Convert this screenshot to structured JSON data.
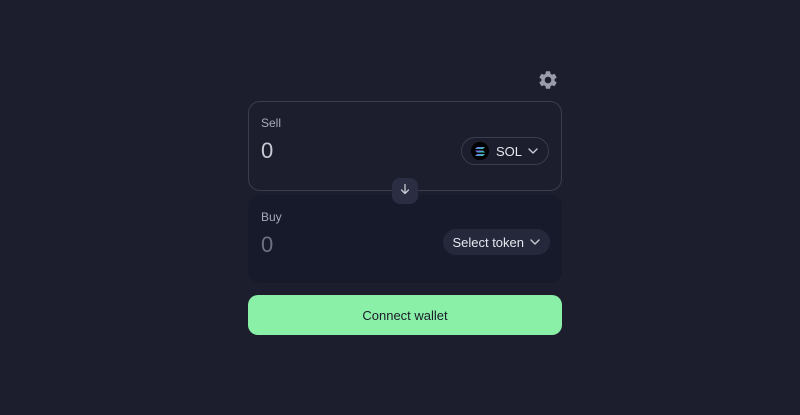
{
  "settings": {
    "icon": "gear-icon"
  },
  "sell": {
    "label": "Sell",
    "amount_placeholder": "0",
    "token": {
      "symbol": "SOL",
      "icon": "solana-logo-icon"
    }
  },
  "swap": {
    "icon": "arrow-down-icon"
  },
  "buy": {
    "label": "Buy",
    "amount_placeholder": "0",
    "token_select_label": "Select token"
  },
  "connect": {
    "label": "Connect wallet"
  },
  "colors": {
    "background": "#1c1e2e",
    "buy_panel": "#171a2b",
    "accent": "#8af0a8",
    "border": "#3a3d50"
  }
}
